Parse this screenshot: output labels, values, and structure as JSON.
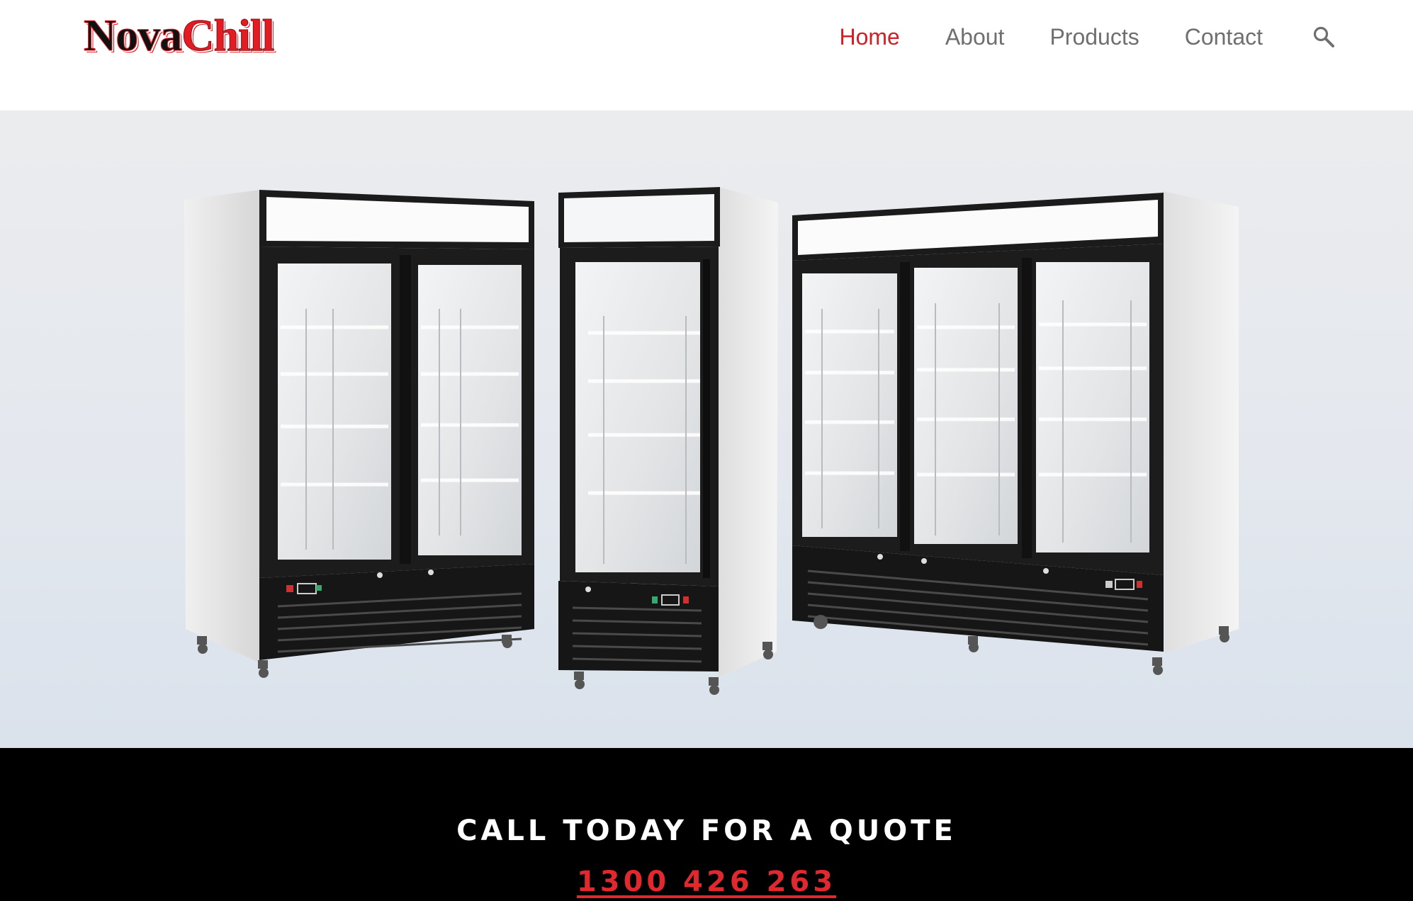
{
  "header": {
    "logo": {
      "part1": "Nova",
      "part2": "Chill"
    },
    "nav": {
      "home": "Home",
      "about": "About",
      "products": "Products",
      "contact": "Contact",
      "active": "home"
    },
    "search_icon": "search-icon"
  },
  "hero": {
    "image_subject": "three glass-door display fridges"
  },
  "cta": {
    "heading": "CALL TODAY FOR A QUOTE",
    "phone": "1300 426 263"
  },
  "colors": {
    "brand_red": "#d21f26",
    "nav_text": "#6f6f6f",
    "cta_background": "#000000",
    "cta_text": "#ffffff",
    "phone_link": "#e0282e"
  }
}
